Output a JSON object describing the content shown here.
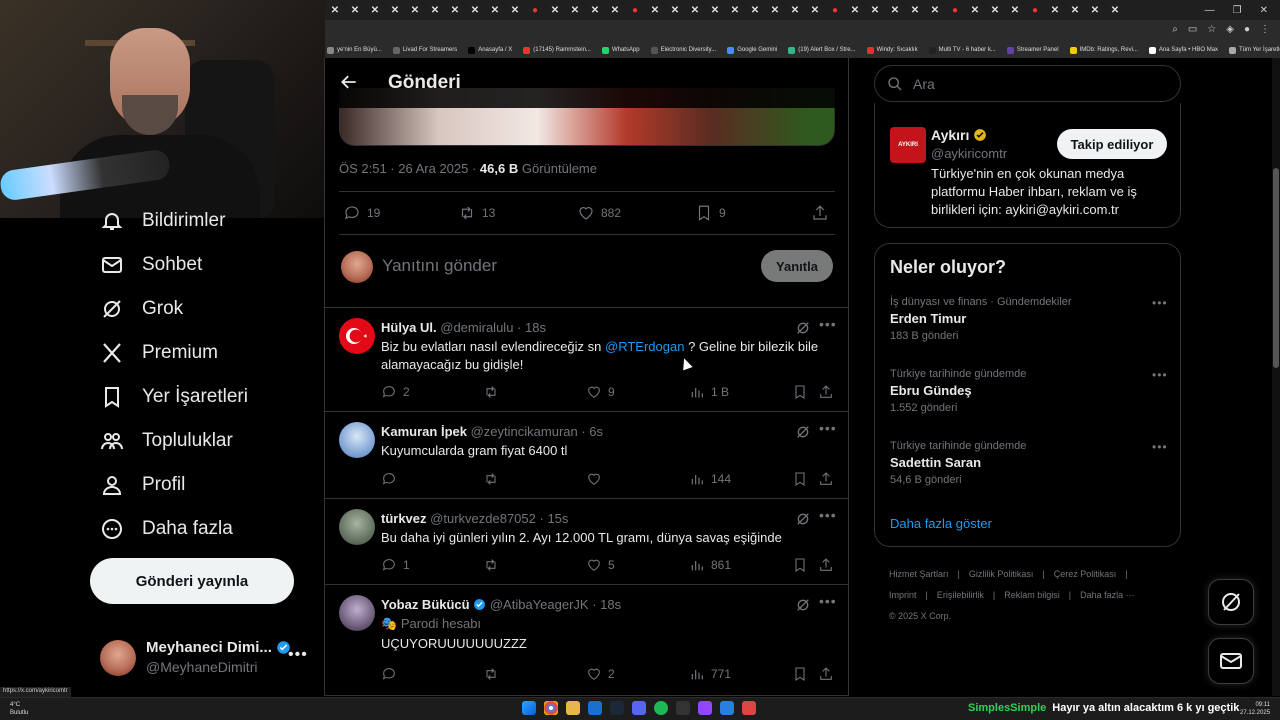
{
  "browser": {
    "tabs_count": 40,
    "bookmarks": [
      {
        "label": "ye'nin En Büyü...",
        "color": "#888"
      },
      {
        "label": "Livad For Streamers",
        "color": "#666"
      },
      {
        "label": "Anasayfa / X",
        "color": "#000"
      },
      {
        "label": "(17145) Rammstein...",
        "color": "#e33"
      },
      {
        "label": "WhatsApp",
        "color": "#25d366"
      },
      {
        "label": "Electronic Diversity...",
        "color": "#555"
      },
      {
        "label": "Google Gemini",
        "color": "#4c8bf5"
      },
      {
        "label": "(19) Alert Box / Stre...",
        "color": "#2dba8a"
      },
      {
        "label": "Windy: Sıcaklık",
        "color": "#d33"
      },
      {
        "label": "Multi TV - 6 haber k...",
        "color": "#222"
      },
      {
        "label": "Streamer Panel",
        "color": "#6441a5"
      },
      {
        "label": "IMDb: Ratings, Revi...",
        "color": "#f5c518"
      },
      {
        "label": "Ana Sayfa • HBO Max",
        "color": "#fff"
      },
      {
        "label": "Tüm Yer İşaretleri",
        "color": "#aaa"
      }
    ]
  },
  "nav": {
    "items": [
      {
        "label": "Bildirimler",
        "icon": "bell-icon"
      },
      {
        "label": "Sohbet",
        "icon": "envelope-icon"
      },
      {
        "label": "Grok",
        "icon": "grok-icon"
      },
      {
        "label": "Premium",
        "icon": "x-logo-icon"
      },
      {
        "label": "Yer İşaretleri",
        "icon": "bookmark-icon"
      },
      {
        "label": "Topluluklar",
        "icon": "people-icon"
      },
      {
        "label": "Profil",
        "icon": "person-icon"
      },
      {
        "label": "Daha fazla",
        "icon": "more-circle-icon"
      }
    ],
    "post_button": "Gönderi yayınla",
    "account": {
      "name": "Meyhaneci Dimi...",
      "handle": "@MeyhaneDimitri",
      "more": "•••"
    }
  },
  "post": {
    "header_title": "Gönderi",
    "time": "ÖS 2:51 · 26 Ara 2025 · ",
    "views": "46,6 B",
    "views_label": " Görüntüleme",
    "stats": {
      "replies": "19",
      "reposts": "13",
      "likes": "882",
      "bookmarks": "9"
    },
    "reply_placeholder": "Yanıtını gönder",
    "reply_button": "Yanıtla"
  },
  "replies": [
    {
      "name": "Hülya Ul.",
      "handle": "@demiralulu",
      "time": "· 18s",
      "text_before": "Biz bu evlatları nasıl evlendireceğiz sn ",
      "mention": "@RTErdogan",
      "text_after": " ? Geline bir bilezik bile alamayacağız bu gidişle!",
      "replies": "2",
      "reposts": "",
      "likes": "9",
      "views": "1 B"
    },
    {
      "name": "Kamuran İpek",
      "handle": "@zeytincikamuran",
      "time": "· 6s",
      "text": "Kuyumcularda gram fiyat 6400 tl",
      "replies": "",
      "reposts": "",
      "likes": "",
      "views": "144"
    },
    {
      "name": "türkvez",
      "handle": "@turkvezde87052",
      "time": "· 15s",
      "text": "Bu daha iyi günleri yılın 2. Ayı 12.000 TL gramı, dünya savaş eşiğinde",
      "replies": "1",
      "reposts": "",
      "likes": "5",
      "views": "861"
    },
    {
      "name": "Yobaz Bükücü",
      "handle": "@AtibaYeagerJK",
      "time": "· 18s",
      "label": "Parodi hesabı",
      "text": "UÇUYORUUUUUUUZZZ",
      "replies": "",
      "reposts": "",
      "likes": "2",
      "views": "771"
    }
  ],
  "right": {
    "search_placeholder": "Ara",
    "profile": {
      "name": "Aykırı",
      "handle": "@aykiricomtr",
      "logo_text": "AYKIRI",
      "bio": "Türkiye'nin en çok okunan medya platformu Haber ihbarı, reklam ve iş birlikleri için: aykiri@aykiri.com.tr",
      "follow_button": "Takip ediliyor"
    },
    "trends_title": "Neler oluyor?",
    "trends": [
      {
        "context": "İş dünyası ve finans · Gündemdekiler",
        "name": "Erden Timur",
        "posts": "183 B gönderi"
      },
      {
        "context": "Türkiye tarihinde gündemde",
        "name": "Ebru Gündeş",
        "posts": "1.552 gönderi"
      },
      {
        "context": "Türkiye tarihinde gündemde",
        "name": "Sadettin Saran",
        "posts": "54,6 B gönderi"
      }
    ],
    "show_more": "Daha fazla göster",
    "footer": {
      "links_row1": [
        "Hizmet Şartları",
        "|",
        "Gizlilik Politikası",
        "|",
        "Çerez Politikası",
        "|"
      ],
      "links_row2": [
        "Imprint",
        "|",
        "Erişilebilirlik",
        "|",
        "Reklam bilgisi",
        "|",
        "Daha fazla ···"
      ],
      "copyright": "© 2025 X Corp."
    }
  },
  "status_url": "https://x.com/aykiricomtr",
  "taskbar": {
    "weather_temp": "4°C",
    "weather_desc": "Bulutlu",
    "ticker_channel": "SimplesSimple",
    "ticker_message": "Hayır ya altın alacaktım 6 k yı geçtik",
    "time": "09:11",
    "date": "27.12.2025"
  },
  "colors": {
    "accent": "#1d9bf0",
    "background": "#000000",
    "muted": "#71767b",
    "turkey_red": "#e30a17"
  }
}
